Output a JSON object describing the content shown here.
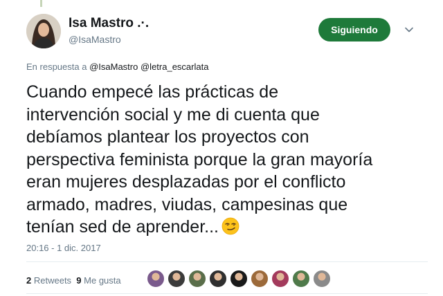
{
  "author": {
    "name": "Isa Mastro .·.",
    "handle": "@IsaMastro"
  },
  "follow_button": {
    "label": "Siguiendo",
    "color": "#1e7a3a"
  },
  "menu": {
    "icon": "chevron-down-icon"
  },
  "reply_context": {
    "prefix": "En respuesta a",
    "mentions": [
      "@IsaMastro",
      "@letra_escarlata"
    ]
  },
  "tweet": {
    "lines": [
      "Cuando empecé las prácticas de",
      "intervención social y me di cuenta que",
      "debíamos plantear los proyectos con",
      "perspectiva feminista porque la gran mayoría",
      "eran mujeres desplazadas por el conflicto",
      "armado, madres, viudas, campesinas que",
      "tenían sed de aprender..."
    ],
    "emoji": "smirking-face-emoji",
    "timestamp": "20:16 - 1 dic. 2017"
  },
  "stats": {
    "retweets_count": "2",
    "retweets_label": "Retweets",
    "likes_count": "9",
    "likes_label": "Me gusta"
  },
  "likers": [
    {
      "color": "#7a5a8c"
    },
    {
      "color": "#3b3b3b"
    },
    {
      "color": "#5a6e4a"
    },
    {
      "color": "#2f2f2f"
    },
    {
      "color": "#1a1a1a"
    },
    {
      "color": "#9c6a3a"
    },
    {
      "color": "#a33a5c"
    },
    {
      "color": "#4f7a4a"
    },
    {
      "color": "#8a8a8a"
    }
  ]
}
